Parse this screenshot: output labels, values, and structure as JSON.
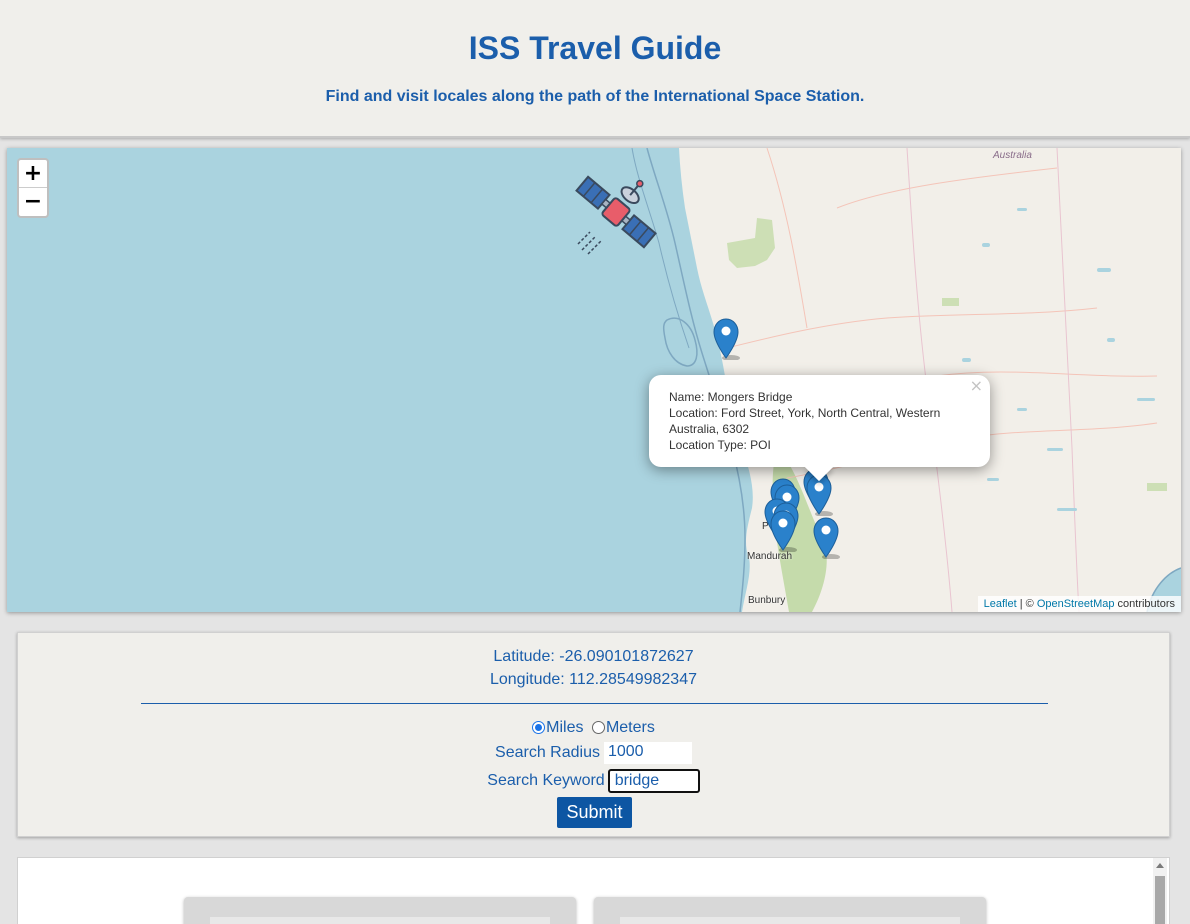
{
  "header": {
    "title": "ISS Travel Guide",
    "subtitle": "Find and visit locales along the path of the International Space Station."
  },
  "map": {
    "zoom_in": "+",
    "zoom_out": "−",
    "labels": {
      "australia": "Australia",
      "mandurah": "Mandurah",
      "bunbury": "Bunbury",
      "perth_partial": "P"
    },
    "popup": {
      "name": "Name: Mongers Bridge",
      "location": "Location: Ford Street, York, North Central, Western Australia, 6302",
      "type": "Location Type: POI",
      "close": "×"
    },
    "attribution": {
      "leaflet": "Leaflet",
      "sep": " | © ",
      "osm": "OpenStreetMap",
      "contributors": " contributors"
    },
    "marker_icon": "map-pin-icon",
    "iss_icon": "satellite-icon"
  },
  "form": {
    "latitude": "Latitude: -26.090101872627",
    "longitude": "Longitude: 112.28549982347",
    "units": {
      "miles": "Miles",
      "meters": "Meters",
      "selected": "Miles"
    },
    "radius_label": "Search Radius",
    "radius_value": "1000",
    "keyword_label": "Search Keyword",
    "keyword_value": "bridge",
    "submit": "Submit"
  },
  "colors": {
    "accent": "#1b5eab",
    "water": "#aad3df",
    "land": "#f2efe9",
    "marker": "#2a81cb"
  }
}
